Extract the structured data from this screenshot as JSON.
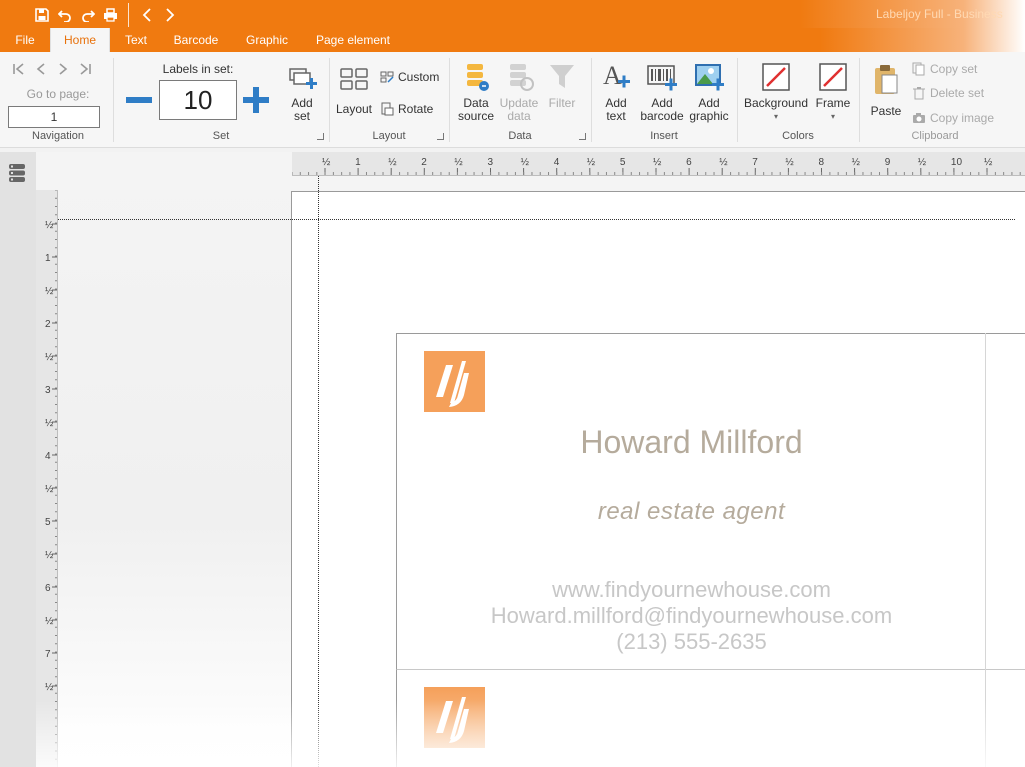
{
  "app": {
    "title": "Labeljoy Full - Business"
  },
  "menu": {
    "tabs": [
      {
        "label": "File"
      },
      {
        "label": "Home"
      },
      {
        "label": "Text"
      },
      {
        "label": "Barcode"
      },
      {
        "label": "Graphic"
      },
      {
        "label": "Page element"
      }
    ],
    "active": "Home"
  },
  "ribbon": {
    "navigation": {
      "goto_label": "Go to page:",
      "page_value": "1",
      "group_label": "Navigation"
    },
    "set": {
      "labels_in_set_label": "Labels in set:",
      "labels_in_set_value": "10",
      "add_set": "Add set",
      "group_label": "Set"
    },
    "layout": {
      "layout_btn": "Layout",
      "custom_btn": "Custom",
      "rotate_btn": "Rotate",
      "group_label": "Layout"
    },
    "data": {
      "data_source": "Data source",
      "update_data": "Update data",
      "filter": "Filter",
      "group_label": "Data"
    },
    "insert": {
      "add_text": "Add text",
      "add_barcode": "Add barcode",
      "add_graphic": "Add graphic",
      "group_label": "Insert"
    },
    "colors": {
      "background": "Background",
      "frame": "Frame",
      "group_label": "Colors"
    },
    "clipboard": {
      "paste": "Paste",
      "copy_set": "Copy set",
      "delete_set": "Delete set",
      "copy_image": "Copy image",
      "group_label": "Clipboard"
    }
  },
  "ruler": {
    "h_marks": [
      "½",
      "1",
      "½",
      "2",
      "½",
      "3",
      "½",
      "4",
      "½",
      "5",
      "½",
      "6",
      "½",
      "7",
      "½",
      "8",
      "½",
      "9",
      "½",
      "10",
      "½"
    ],
    "v_marks": [
      "½",
      "1",
      "½",
      "2",
      "½",
      "3",
      "½",
      "4",
      "½",
      "5",
      "½",
      "6",
      "½",
      "7",
      "½"
    ]
  },
  "label": {
    "name": "Howard Millford",
    "title": "real estate agent",
    "website": "www.findyournewhouse.com",
    "email": "Howard.millford@findyournewhouse.com",
    "phone": "(213) 555-2635"
  },
  "colors": {
    "accent": "#f07a10",
    "logo": "#f5a05a",
    "name_text": "#b5ab9c",
    "contact_text": "#c7c7c7"
  }
}
